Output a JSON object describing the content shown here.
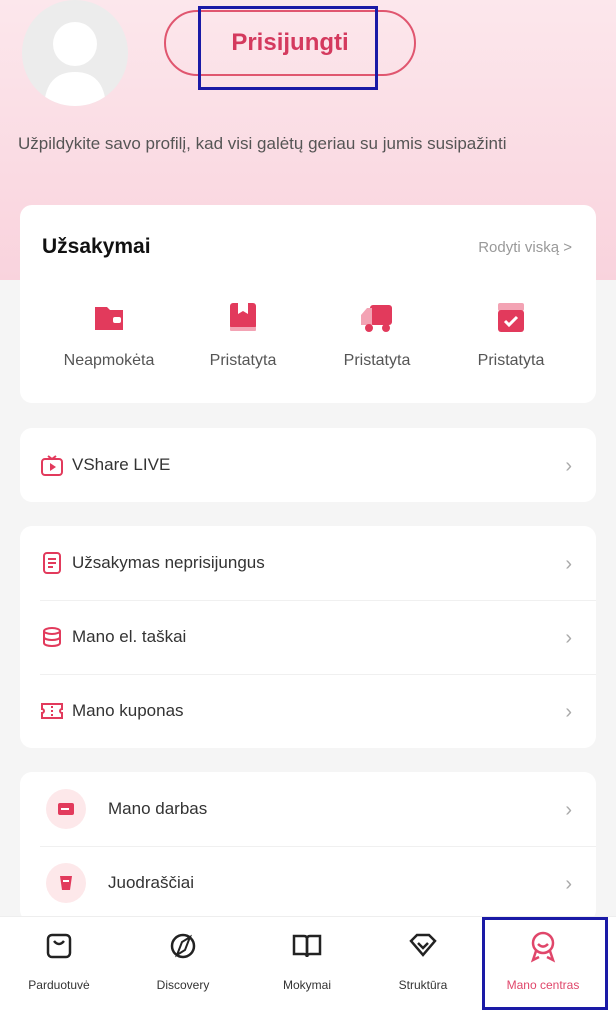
{
  "header": {
    "login_label": "Prisijungti",
    "profile_hint": "Užpildykite savo profilį, kad visi galėtų geriau su jumis susipažinti"
  },
  "orders": {
    "title": "Užsakymai",
    "view_all": "Rodyti viską >",
    "items": [
      {
        "label": "Neapmokėta",
        "icon": "wallet-icon"
      },
      {
        "label": "Pristatyta",
        "icon": "bookmark-box-icon"
      },
      {
        "label": "Pristatyta",
        "icon": "truck-icon"
      },
      {
        "label": "Pristatyta",
        "icon": "received-box-icon"
      }
    ]
  },
  "live": {
    "label": "VShare LIVE",
    "icon": "live-tv-icon"
  },
  "menu": {
    "items": [
      {
        "label": "Užsakymas neprisijungus",
        "icon": "document-icon"
      },
      {
        "label": "Mano el. taškai",
        "icon": "database-icon"
      },
      {
        "label": "Mano kuponas",
        "icon": "coupon-icon"
      }
    ]
  },
  "extra": {
    "items": [
      {
        "label": "Mano darbas",
        "icon": "card-icon"
      },
      {
        "label": "Juodraščiai",
        "icon": "cup-icon"
      }
    ]
  },
  "tabbar": {
    "items": [
      {
        "label": "Parduotuvė",
        "icon": "shopping-bag-icon"
      },
      {
        "label": "Discovery",
        "icon": "compass-icon"
      },
      {
        "label": "Mokymai",
        "icon": "book-icon"
      },
      {
        "label": "Struktūra",
        "icon": "diamond-icon"
      },
      {
        "label": "Mano centras",
        "icon": "profile-badge-icon"
      }
    ],
    "active_index": 4
  },
  "colors": {
    "accent": "#e0466a",
    "highlight_border": "#1a1aa6"
  }
}
